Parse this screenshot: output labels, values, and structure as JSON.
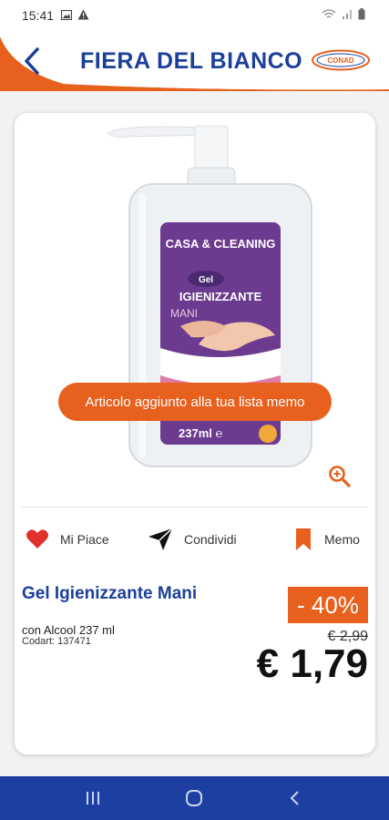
{
  "status_bar": {
    "time": "15:41",
    "left_icons": [
      "image-icon",
      "warning-icon"
    ],
    "right_icons": [
      "wifi-icon",
      "signal-icon",
      "battery-icon"
    ]
  },
  "header": {
    "title": "FIERA DEL BIANCO",
    "logo_text": "CONAD",
    "back_icon": "chevron-left-icon"
  },
  "product_image": {
    "brand": "CASA & CLEANING",
    "badge": "Gel",
    "line1": "IGIENIZZANTE",
    "line2": "MANI",
    "volume": "237ml ℮"
  },
  "toast": {
    "text": "Articolo aggiunto alla tua lista memo"
  },
  "actions": {
    "like_label": "Mi Piace",
    "share_label": "Condividi",
    "memo_label": "Memo"
  },
  "product": {
    "name": "Gel Igienizzante Mani",
    "description": "con Alcool 237 ml",
    "code": "Codart: 137471",
    "discount": "- 40%",
    "old_price": "€ 2,99",
    "new_price": "€ 1,79"
  },
  "colors": {
    "brand_blue": "#1b3f9a",
    "accent_orange": "#e8601d",
    "nav_blue": "#1d3fa1"
  }
}
